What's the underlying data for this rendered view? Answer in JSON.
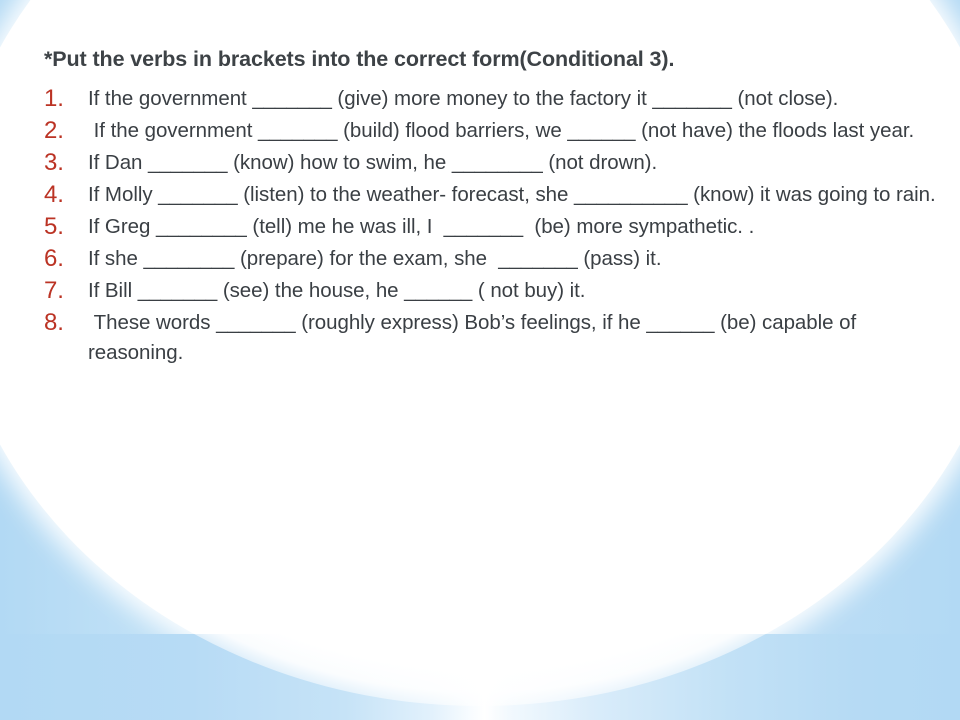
{
  "slide": {
    "heading": "*Put the verbs in brackets into the correct form(Conditional 3).",
    "heading_marker": "*",
    "colors": {
      "background_blue": "#b2d9f4",
      "panel_white": "#ffffff",
      "number_red": "#bb3324",
      "body_text": "#3a3f44",
      "heading_text": "#3d4246"
    },
    "questions": [
      {
        "number": "1.",
        "text": "If the government _______ (give) more money to the factory it _______ (not close)."
      },
      {
        "number": "2.",
        "text": " If the government _______ (build) flood barriers, we ______ (not have) the floods last year."
      },
      {
        "number": "3.",
        "text": "If Dan _______ (know) how to swim, he ________ (not drown)."
      },
      {
        "number": "4.",
        "text": "If Molly _______ (listen) to the weather- forecast, she __________ (know) it was going to rain."
      },
      {
        "number": "5.",
        "text": "If Greg ________ (tell) me he was ill, I  _______  (be) more sympathetic. ."
      },
      {
        "number": "6.",
        "text": "If she ________ (prepare) for the exam, she  _______ (pass) it."
      },
      {
        "number": "7.",
        "text": "If Bill _______ (see) the house, he ______ ( not buy) it."
      },
      {
        "number": "8.",
        "text": " These words _______ (roughly express) Bob’s feelings, if he ______ (be) capable of reasoning."
      }
    ]
  }
}
